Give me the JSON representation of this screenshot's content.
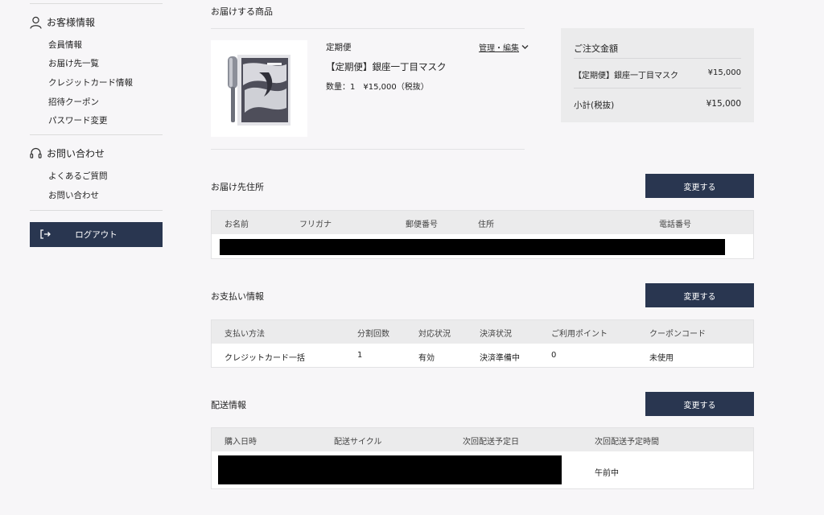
{
  "sidebar": {
    "customer_heading": "お客様情報",
    "customer_links": [
      "会員情報",
      "お届け先一覧",
      "クレジットカード情報",
      "招待クーポン",
      "パスワード変更"
    ],
    "contact_heading": "お問い合わせ",
    "contact_links": [
      "よくあるご質問",
      "お問い合わせ"
    ],
    "logout_label": "ログアウト"
  },
  "products": {
    "title": "お届けする商品",
    "manage_label": "管理・編集",
    "item": {
      "type": "定期便",
      "name": "【定期便】銀座一丁目マスク",
      "qty_price": "数量：1　¥15,000（税抜）"
    }
  },
  "summary": {
    "title": "ご注文金額",
    "item_name": "【定期便】銀座一丁目マスク",
    "item_price": "¥15,000",
    "subtotal_label": "小計(税抜)",
    "subtotal_value": "¥15,000"
  },
  "address": {
    "title": "お届け先住所",
    "change_label": "変更する",
    "headers": [
      "お名前",
      "フリガナ",
      "郵便番号",
      "住所",
      "電話番号"
    ]
  },
  "payment": {
    "title": "お支払い情報",
    "change_label": "変更する",
    "headers": [
      "支払い方法",
      "分割回数",
      "対応状況",
      "決済状況",
      "ご利用ポイント",
      "クーポンコード"
    ],
    "row": [
      "クレジットカード一括",
      "1",
      "有効",
      "決済準備中",
      "0",
      "未使用"
    ]
  },
  "shipping": {
    "title": "配送情報",
    "change_label": "変更する",
    "headers": [
      "購入日時",
      "配送サイクル",
      "次回配送予定日",
      "次回配送予定時間"
    ],
    "next_time": "午前中"
  },
  "colors": {
    "button": "#293650",
    "background": "#f7f6f8",
    "table_header": "#ebebec"
  }
}
